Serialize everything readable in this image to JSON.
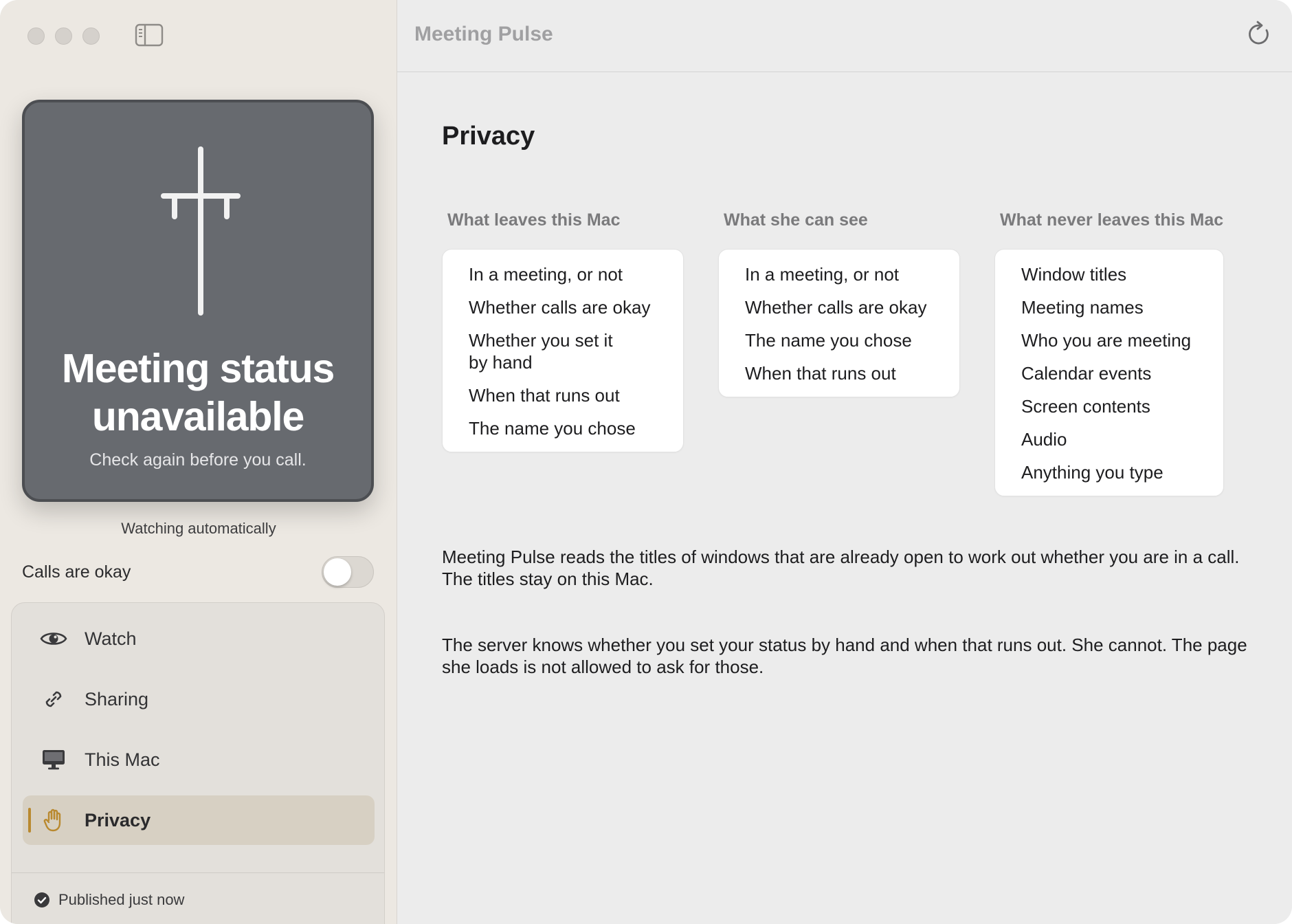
{
  "app": {
    "window_title": "Meeting Pulse"
  },
  "sidebar": {
    "status_card": {
      "title": "Meeting status unavailable",
      "subtitle": "Check again before you call.",
      "background_color": "#676a6f"
    },
    "watching_label": "Watching automatically",
    "calls_okay": {
      "label": "Calls are okay",
      "on": false
    },
    "nav_items": [
      {
        "label": "Watch",
        "icon": "eye-icon",
        "active": false
      },
      {
        "label": "Sharing",
        "icon": "link-icon",
        "active": false
      },
      {
        "label": "This Mac",
        "icon": "display-icon",
        "active": false
      },
      {
        "label": "Privacy",
        "icon": "hand-icon",
        "active": true
      }
    ],
    "footer": {
      "label": "Published just now",
      "icon": "checkmark-circle-icon"
    },
    "accent_color": "#b9892f"
  },
  "main": {
    "page_title": "Privacy",
    "columns": [
      {
        "heading": "What leaves this Mac",
        "items": [
          "In a meeting, or not",
          "Whether calls are okay",
          "Whether you set it by hand",
          "When that runs out",
          "The name you chose"
        ]
      },
      {
        "heading": "What she can see",
        "items": [
          "In a meeting, or not",
          "Whether calls are okay",
          "The name you chose",
          "When that runs out"
        ]
      },
      {
        "heading": "What never leaves this Mac",
        "items": [
          "Window titles",
          "Meeting names",
          "Who you are meeting",
          "Calendar events",
          "Screen contents",
          "Audio",
          "Anything you type"
        ]
      }
    ],
    "paragraphs": [
      "Meeting Pulse reads the titles of windows that are already open to work out whether you are in a call. The titles stay on this Mac.",
      "The server knows whether you set your status by hand and when that runs out. She cannot. The page she loads is not allowed to ask for those."
    ]
  }
}
